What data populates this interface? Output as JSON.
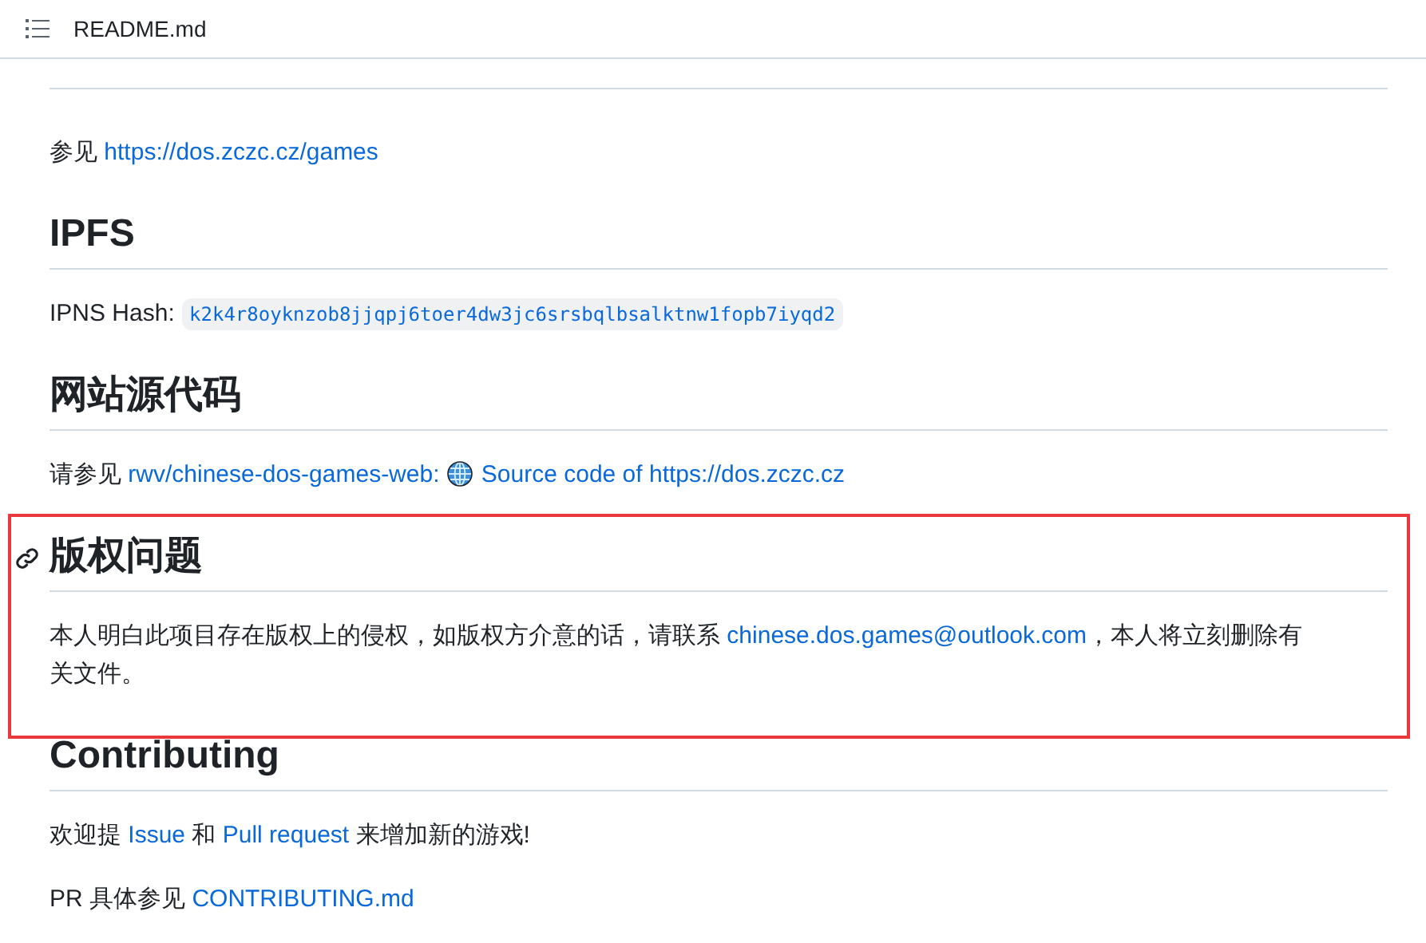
{
  "header": {
    "title": "README.md"
  },
  "sections": [
    {
      "anchor_visible": false,
      "highlighted": false,
      "paragraphs": [
        [
          {
            "kind": "text",
            "text": "参见 "
          },
          {
            "kind": "link",
            "text": "https://dos.zczc.cz/games"
          }
        ]
      ]
    },
    {
      "heading": "IPFS",
      "anchor_visible": false,
      "highlighted": false,
      "paragraphs": [
        [
          {
            "kind": "text",
            "text": "IPNS Hash: "
          },
          {
            "kind": "code",
            "text": "k2k4r8oyknzob8jjqpj6toer4dw3jc6srsbqlbsalktnw1fopb7iyqd2"
          }
        ]
      ]
    },
    {
      "heading": "网站源代码",
      "anchor_visible": false,
      "highlighted": false,
      "paragraphs": [
        [
          {
            "kind": "text",
            "text": "请参见 "
          },
          {
            "kind": "link",
            "text": "rwv/chinese-dos-games-web:"
          },
          {
            "kind": "icon"
          },
          {
            "kind": "link",
            "text": "Source code of https://dos.zczc.cz"
          }
        ]
      ]
    },
    {
      "heading": "版权问题",
      "anchor_visible": true,
      "highlighted": true,
      "paragraphs": [
        [
          {
            "kind": "text",
            "text": "本人明白此项目存在版权上的侵权，如版权方介意的话，请联系 "
          },
          {
            "kind": "link",
            "text": "chinese.dos.games@outlook.com"
          },
          {
            "kind": "text",
            "text": "，本人将立刻删除有关文件。"
          }
        ]
      ]
    },
    {
      "heading": "Contributing",
      "anchor_visible": false,
      "highlighted": false,
      "paragraphs": [
        [
          {
            "kind": "text",
            "text": "欢迎提 "
          },
          {
            "kind": "link",
            "text": "Issue"
          },
          {
            "kind": "text",
            "text": " 和 "
          },
          {
            "kind": "link",
            "text": "Pull request"
          },
          {
            "kind": "text",
            "text": " 来增加新的游戏!"
          }
        ],
        [
          {
            "kind": "text",
            "text": "PR 具体参见 "
          },
          {
            "kind": "link",
            "text": "CONTRIBUTING.md"
          }
        ]
      ]
    }
  ]
}
